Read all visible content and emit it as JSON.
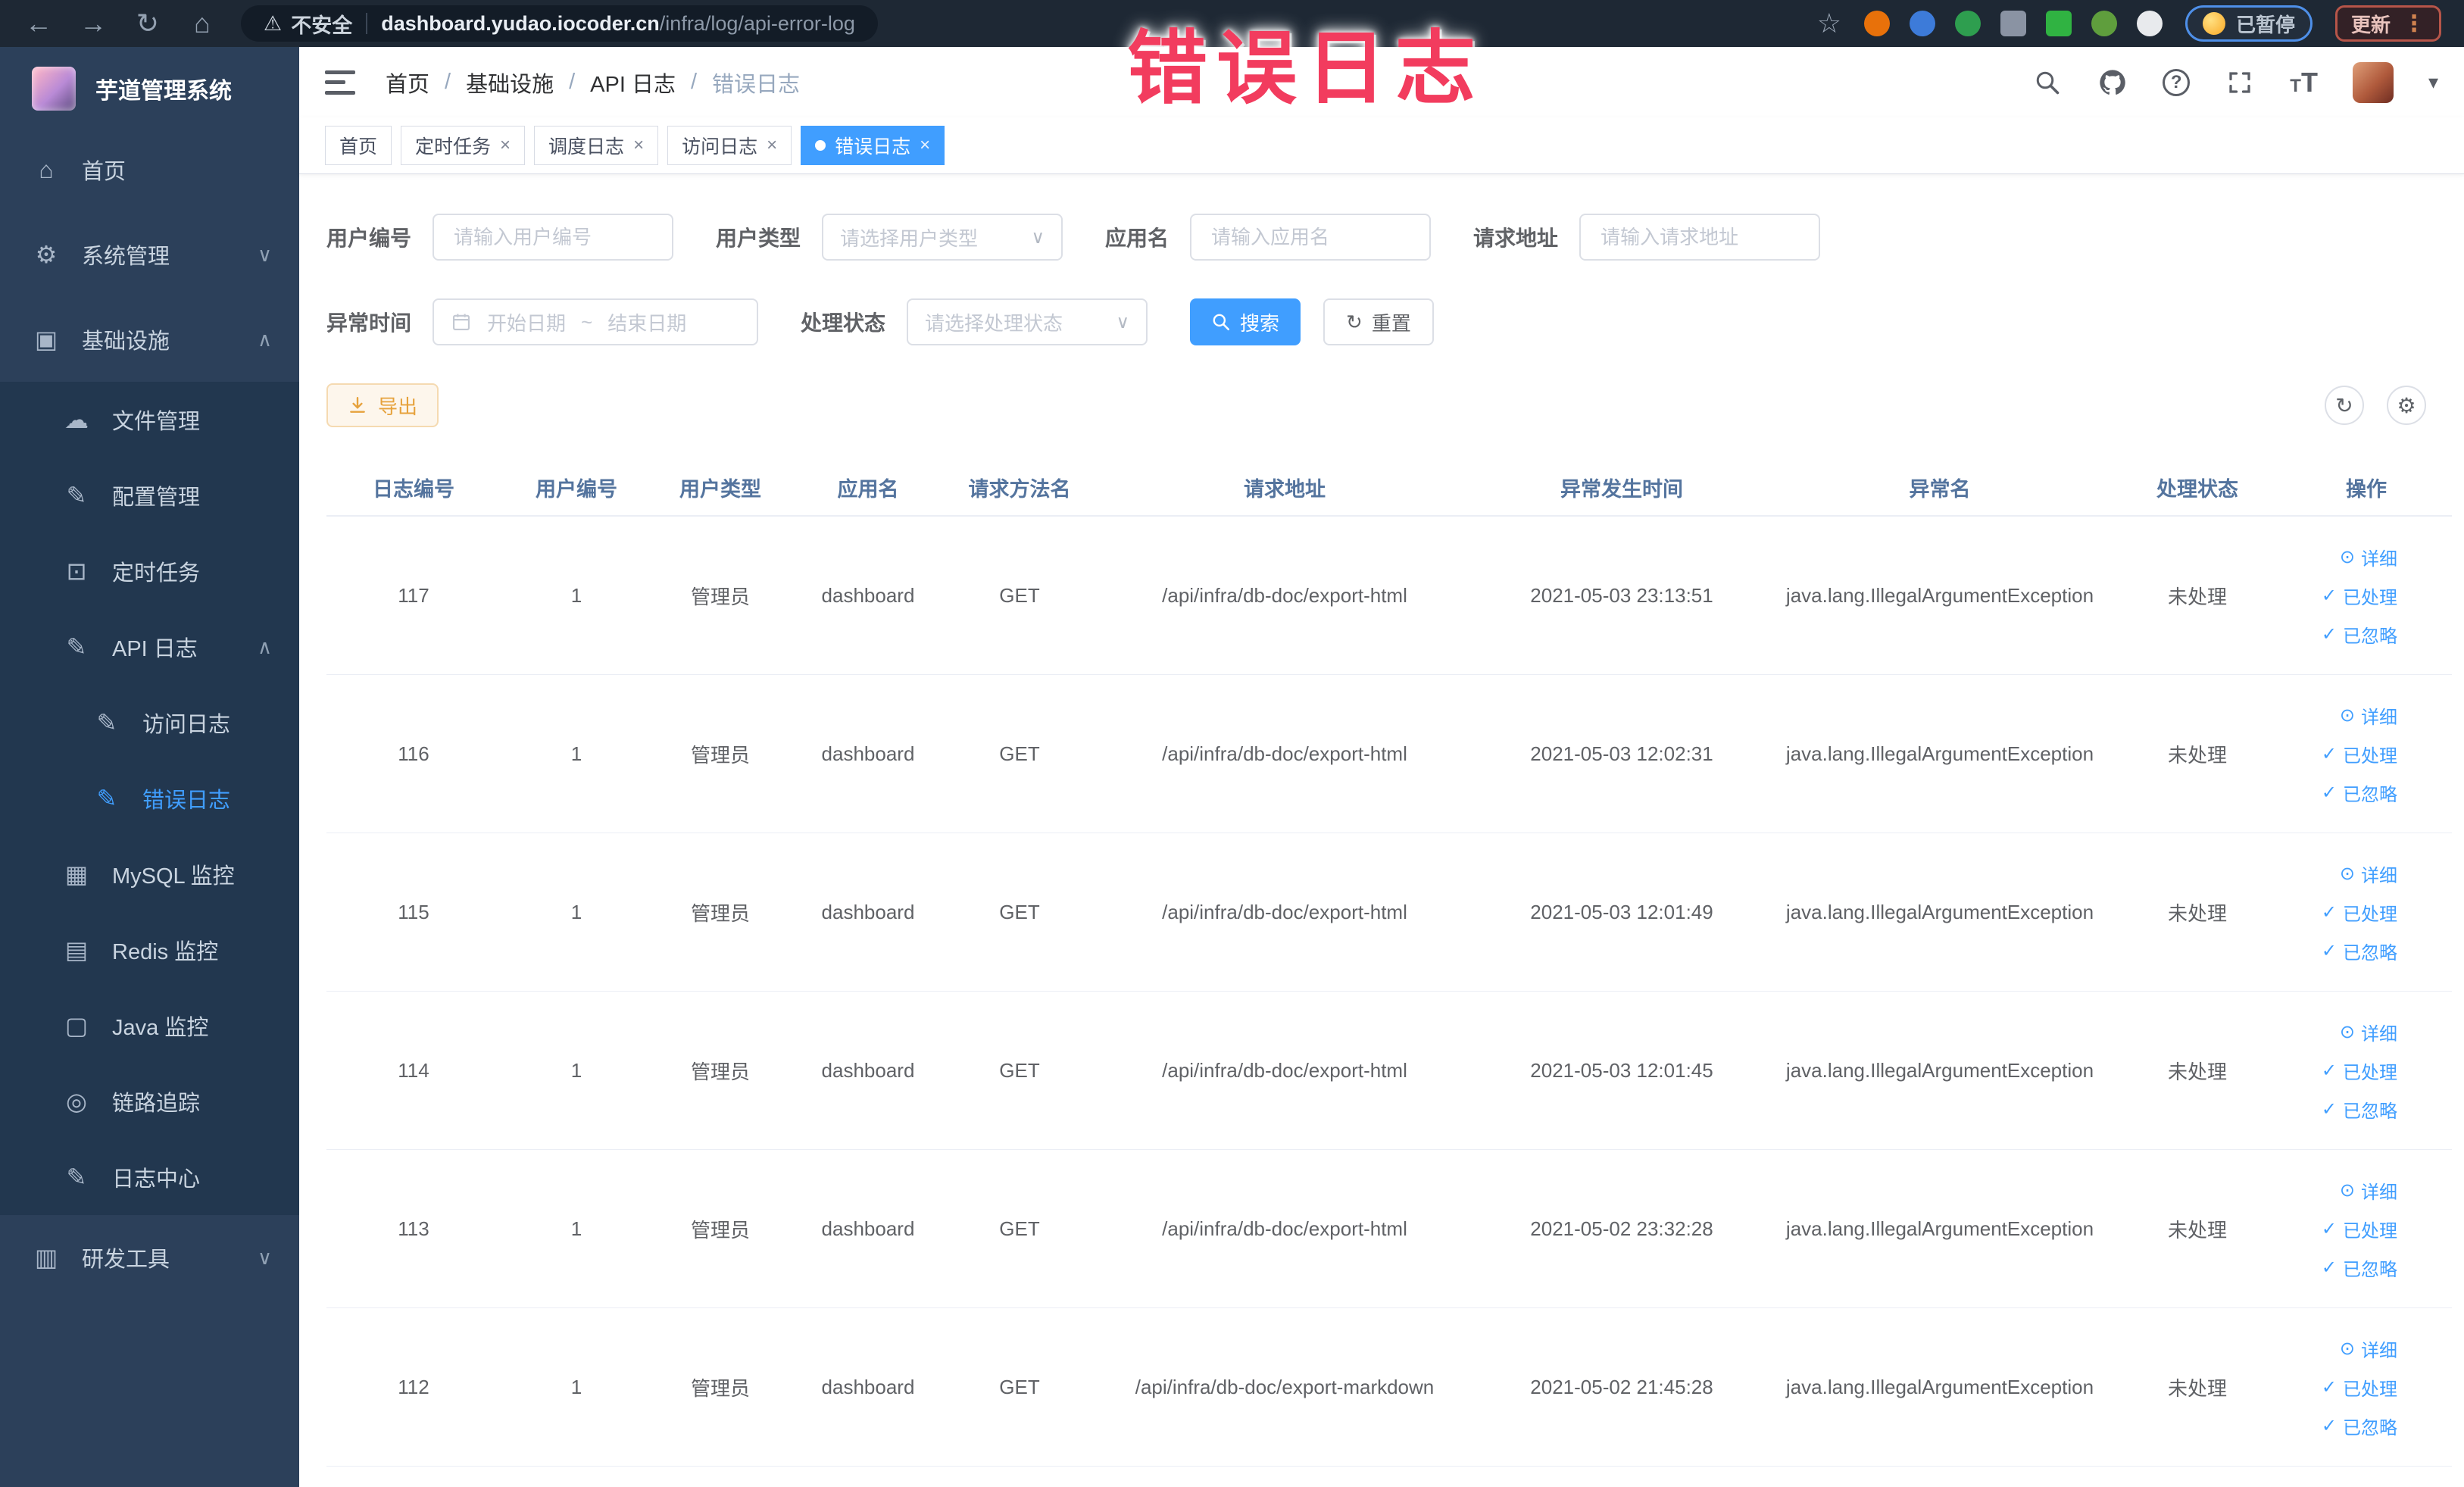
{
  "colors": {
    "accent": "#409eff",
    "warning": "#e6a23c",
    "overlay_red": "#f23c5e",
    "sidebar_bg": "#2c405a",
    "submenu_bg": "#22374f"
  },
  "overlay_title": "错误日志",
  "browser": {
    "security_label": "不安全",
    "url_domain": "dashboard.yudao.iocoder.cn",
    "url_path": "/infra/log/api-error-log",
    "paused_badge_label": "已暂停",
    "update_button_label": "更新",
    "extensions": [
      {
        "name": "extension-icon-orange",
        "color": "#e8710a",
        "shape": "circle"
      },
      {
        "name": "extension-icon-blue",
        "color": "#3d7bd9",
        "shape": "circle"
      },
      {
        "name": "extension-icon-green-check",
        "color": "#2e9e4f",
        "shape": "circle"
      },
      {
        "name": "extension-icon-grid",
        "color": "#8a93a3",
        "shape": "square"
      },
      {
        "name": "extension-icon-dark-off",
        "color": "#30b342",
        "shape": "square"
      },
      {
        "name": "extension-icon-leaf",
        "color": "#5f9e3d",
        "shape": "circle"
      },
      {
        "name": "extension-icon-star",
        "color": "#e8eaed",
        "shape": "circle"
      }
    ]
  },
  "sidebar": {
    "app_title": "芋道管理系统",
    "items": [
      {
        "label": "首页",
        "icon": "home-icon",
        "level": 1
      },
      {
        "label": "系统管理",
        "icon": "gear-icon",
        "level": 1,
        "chevron": "down"
      },
      {
        "label": "基础设施",
        "icon": "infrastructure-icon",
        "level": 1,
        "chevron": "up"
      },
      {
        "label": "文件管理",
        "icon": "file-manage-icon",
        "level": 2
      },
      {
        "label": "配置管理",
        "icon": "config-manage-icon",
        "level": 2
      },
      {
        "label": "定时任务",
        "icon": "timer-task-icon",
        "level": 2
      },
      {
        "label": "API 日志",
        "icon": "api-log-icon",
        "level": 2,
        "chevron": "up"
      },
      {
        "label": "访问日志",
        "icon": "access-log-icon",
        "level": 3
      },
      {
        "label": "错误日志",
        "icon": "error-log-icon",
        "level": 3,
        "active": true
      },
      {
        "label": "MySQL 监控",
        "icon": "mysql-monitor-icon",
        "level": 2
      },
      {
        "label": "Redis 监控",
        "icon": "redis-monitor-icon",
        "level": 2
      },
      {
        "label": "Java 监控",
        "icon": "java-monitor-icon",
        "level": 2
      },
      {
        "label": "链路追踪",
        "icon": "trace-icon",
        "level": 2
      },
      {
        "label": "日志中心",
        "icon": "log-center-icon",
        "level": 2
      },
      {
        "label": "研发工具",
        "icon": "dev-tools-icon",
        "level": 1,
        "chevron": "down"
      }
    ]
  },
  "header": {
    "breadcrumb": [
      "首页",
      "基础设施",
      "API 日志",
      "错误日志"
    ]
  },
  "tabs": [
    {
      "label": "首页",
      "closable": false,
      "active": false
    },
    {
      "label": "定时任务",
      "closable": true,
      "active": false
    },
    {
      "label": "调度日志",
      "closable": true,
      "active": false
    },
    {
      "label": "访问日志",
      "closable": true,
      "active": false
    },
    {
      "label": "错误日志",
      "closable": true,
      "active": true
    }
  ],
  "filters": {
    "user_id": {
      "label": "用户编号",
      "placeholder": "请输入用户编号"
    },
    "user_type": {
      "label": "用户类型",
      "placeholder": "请选择用户类型"
    },
    "app_name": {
      "label": "应用名",
      "placeholder": "请输入应用名"
    },
    "request_url": {
      "label": "请求地址",
      "placeholder": "请输入请求地址"
    },
    "exception_time": {
      "label": "异常时间",
      "start_placeholder": "开始日期",
      "separator": "~",
      "end_placeholder": "结束日期"
    },
    "process_status": {
      "label": "处理状态",
      "placeholder": "请选择处理状态"
    },
    "search_label": "搜索",
    "reset_label": "重置"
  },
  "toolbar": {
    "export_label": "导出"
  },
  "table": {
    "columns": [
      "日志编号",
      "用户编号",
      "用户类型",
      "应用名",
      "请求方法名",
      "请求地址",
      "异常发生时间",
      "异常名",
      "处理状态",
      "操作"
    ],
    "action_labels": [
      "详细",
      "已处理",
      "已忽略"
    ],
    "rows": [
      {
        "id": "117",
        "user_id": "1",
        "user_type": "管理员",
        "app": "dashboard",
        "method": "GET",
        "url": "/api/infra/db-doc/export-html",
        "time": "2021-05-03 23:13:51",
        "exception": "java.lang.IllegalArgumentException",
        "status": "未处理"
      },
      {
        "id": "116",
        "user_id": "1",
        "user_type": "管理员",
        "app": "dashboard",
        "method": "GET",
        "url": "/api/infra/db-doc/export-html",
        "time": "2021-05-03 12:02:31",
        "exception": "java.lang.IllegalArgumentException",
        "status": "未处理"
      },
      {
        "id": "115",
        "user_id": "1",
        "user_type": "管理员",
        "app": "dashboard",
        "method": "GET",
        "url": "/api/infra/db-doc/export-html",
        "time": "2021-05-03 12:01:49",
        "exception": "java.lang.IllegalArgumentException",
        "status": "未处理"
      },
      {
        "id": "114",
        "user_id": "1",
        "user_type": "管理员",
        "app": "dashboard",
        "method": "GET",
        "url": "/api/infra/db-doc/export-html",
        "time": "2021-05-03 12:01:45",
        "exception": "java.lang.IllegalArgumentException",
        "status": "未处理"
      },
      {
        "id": "113",
        "user_id": "1",
        "user_type": "管理员",
        "app": "dashboard",
        "method": "GET",
        "url": "/api/infra/db-doc/export-html",
        "time": "2021-05-02 23:32:28",
        "exception": "java.lang.IllegalArgumentException",
        "status": "未处理"
      },
      {
        "id": "112",
        "user_id": "1",
        "user_type": "管理员",
        "app": "dashboard",
        "method": "GET",
        "url": "/api/infra/db-doc/export-markdown",
        "time": "2021-05-02 21:45:28",
        "exception": "java.lang.IllegalArgumentException",
        "status": "未处理"
      }
    ]
  }
}
